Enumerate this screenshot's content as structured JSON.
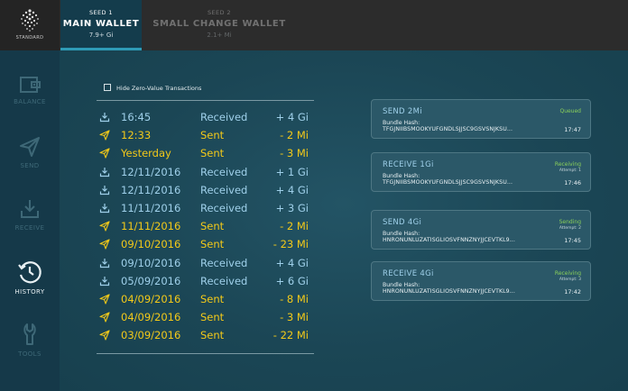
{
  "logo": {
    "text": "STANDARD",
    "icon": "iota-logo-icon"
  },
  "seeds": [
    {
      "number": "SEED 1",
      "name": "MAIN WALLET",
      "balance": "7.9+ Gi",
      "active": true
    },
    {
      "number": "SEED 2",
      "name": "SMALL CHANGE WALLET",
      "balance": "2.1+ Mi",
      "active": false
    }
  ],
  "sidebar": {
    "items": [
      {
        "label": "BALANCE",
        "icon": "wallet-icon",
        "active": false
      },
      {
        "label": "SEND",
        "icon": "paper-plane-icon",
        "active": false
      },
      {
        "label": "RECEIVE",
        "icon": "download-icon",
        "active": false
      },
      {
        "label": "HISTORY",
        "icon": "clock-history-icon",
        "active": true
      },
      {
        "label": "TOOLS",
        "icon": "wrench-icon",
        "active": false
      }
    ]
  },
  "filter": {
    "label": "Hide Zero-Value Transactions",
    "checked": false
  },
  "transactions": [
    {
      "time": "16:45",
      "type": "Received",
      "amount": "+ 4 Gi"
    },
    {
      "time": "12:33",
      "type": "Sent",
      "amount": "- 2 Mi"
    },
    {
      "time": "Yesterday",
      "type": "Sent",
      "amount": "- 3 Mi"
    },
    {
      "time": "12/11/2016",
      "type": "Received",
      "amount": "+ 1 Gi"
    },
    {
      "time": "12/11/2016",
      "type": "Received",
      "amount": "+ 4 Gi"
    },
    {
      "time": "11/11/2016",
      "type": "Received",
      "amount": "+ 3 Gi"
    },
    {
      "time": "11/11/2016",
      "type": "Sent",
      "amount": "- 2 Mi"
    },
    {
      "time": "09/10/2016",
      "type": "Sent",
      "amount": "- 23 Mi"
    },
    {
      "time": "09/10/2016",
      "type": "Received",
      "amount": "+ 4 Gi"
    },
    {
      "time": "05/09/2016",
      "type": "Received",
      "amount": "+ 6 Gi"
    },
    {
      "time": "04/09/2016",
      "type": "Sent",
      "amount": "- 8 Mi"
    },
    {
      "time": "04/09/2016",
      "type": "Sent",
      "amount": "- 3 Mi"
    },
    {
      "time": "03/09/2016",
      "type": "Sent",
      "amount": "- 22 Mi"
    }
  ],
  "bundles": [
    {
      "title": "SEND 2Mi",
      "status": "Queued",
      "attempt": "",
      "hash_label": "Bundle Hash:",
      "hash": "TFGJNIIBSMOOKYUFGNDLSJJSC9GSVSNJKSU...",
      "time": "17:47"
    },
    {
      "title": "RECEIVE 1Gi",
      "status": "Receiving",
      "attempt": "Attempt: 1",
      "hash_label": "Bundle Hash:",
      "hash": "TFGJNIIBSMOOKYUFGNDLSJJSC9GSVSNJKSU...",
      "time": "17:46"
    },
    {
      "title": "SEND 4Gi",
      "status": "Sending",
      "attempt": "Attempt: 2",
      "hash_label": "Bundle Hash:",
      "hash": "HNRONUNLUZATISGLIOSVFNNZNYJJCEVTKL9...",
      "time": "17:45"
    },
    {
      "title": "RECEIVE 4Gi",
      "status": "Receiving",
      "attempt": "Attempt: 3",
      "hash_label": "Bundle Hash:",
      "hash": "HNRONUNLUZATISGLIOSVFNNZNYJJCEVTKL9...",
      "time": "17:42"
    }
  ],
  "colors": {
    "received": "#9fd0ea",
    "sent": "#f3c919",
    "status_green": "#8ad05a",
    "active_tab": "#143c4c",
    "accent": "#2e9bb6"
  }
}
